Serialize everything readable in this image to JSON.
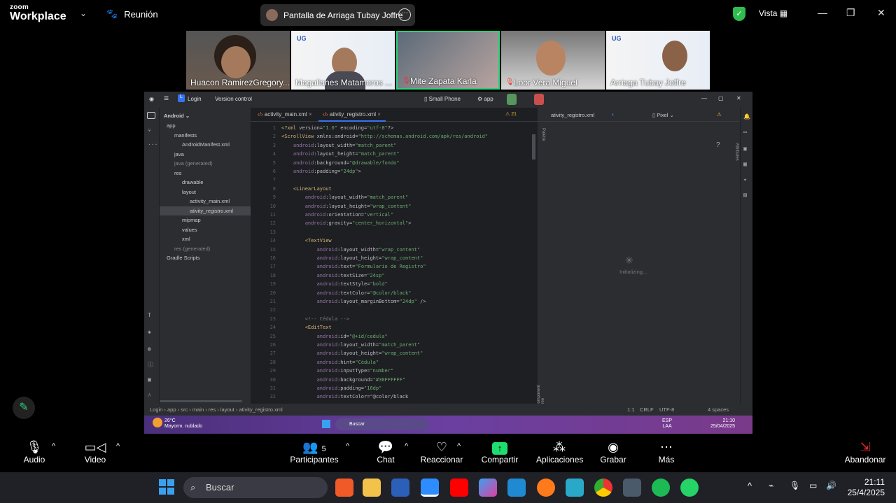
{
  "zoom": {
    "logo_line1": "zoom",
    "logo_line2": "Workplace",
    "meeting_label": "Reunión",
    "share_title": "Pantalla de Arriaga Tubay Joffre",
    "view_label": "Vista",
    "participants": [
      {
        "name": "Huacon RamirezGregory..."
      },
      {
        "name": "Magallanes Matamoros ..."
      },
      {
        "name": "Mite Zapata Karla"
      },
      {
        "name": "Loor Vera Miguel"
      },
      {
        "name": "Arriaga Tubay Joffre"
      }
    ],
    "toolbar": {
      "audio": "Audio",
      "video": "Video",
      "participants": "Participantes",
      "participants_count": "5",
      "chat": "Chat",
      "react": "Reaccionar",
      "share": "Compartir",
      "apps": "Aplicaciones",
      "record": "Grabar",
      "more": "Más",
      "leave": "Abandonar"
    }
  },
  "ide": {
    "project_name": "Login",
    "vcs": "Version control",
    "device": "Small Phone",
    "run_config": "app",
    "view_mode": "Android",
    "tree": [
      {
        "label": "app",
        "depth": 0
      },
      {
        "label": "manifests",
        "depth": 1
      },
      {
        "label": "AndroidManifest.xml",
        "depth": 2
      },
      {
        "label": "java",
        "depth": 1
      },
      {
        "label": "java (generated)",
        "depth": 1
      },
      {
        "label": "res",
        "depth": 1
      },
      {
        "label": "drawable",
        "depth": 2
      },
      {
        "label": "layout",
        "depth": 2
      },
      {
        "label": "activity_main.xml",
        "depth": 3
      },
      {
        "label": "ativity_registro.xml",
        "depth": 3
      },
      {
        "label": "mipmap",
        "depth": 2
      },
      {
        "label": "values",
        "depth": 2
      },
      {
        "label": "xml",
        "depth": 2
      },
      {
        "label": "res (generated)",
        "depth": 1
      },
      {
        "label": "Gradle Scripts",
        "depth": 0
      }
    ],
    "tabs": [
      "activity_main.xml",
      "ativity_registro.xml"
    ],
    "warnings": "21",
    "code_lines": [
      "<?xml version=\"1.0\" encoding=\"utf-8\"?>",
      "<ScrollView xmlns:android=\"http://schemas.android.com/apk/res/android\"",
      "    android:layout_width=\"match_parent\"",
      "    android:layout_height=\"match_parent\"",
      "    android:background=\"@drawable/fondo\"",
      "    android:padding=\"24dp\">",
      "",
      "    <LinearLayout",
      "        android:layout_width=\"match_parent\"",
      "        android:layout_height=\"wrap_content\"",
      "        android:orientation=\"vertical\"",
      "        android:gravity=\"center_horizontal\">",
      "",
      "        <TextView",
      "            android:layout_width=\"wrap_content\"",
      "            android:layout_height=\"wrap_content\"",
      "            android:text=\"Formulario de Registro\"",
      "            android:textSize=\"24sp\"",
      "            android:textStyle=\"bold\"",
      "            android:textColor=\"@color/black\"",
      "            android:layout_marginBottom=\"24dp\" />",
      "",
      "        <!-- Cédula -->",
      "        <EditText",
      "            android:id=\"@+id/cedula\"",
      "            android:layout_width=\"match_parent\"",
      "            android:layout_height=\"wrap_content\"",
      "            android:hint=\"Cédula\"",
      "            android:inputType=\"number\"",
      "            android:background=\"#30FFFFFF\"",
      "            android:padding=\"16dp\"",
      "            android:textColor=\"@color/black"
    ],
    "preview_file": "ativity_registro.xml",
    "preview_device": "Pixel",
    "preview_status": "Initializing...",
    "palette_label": "Palette",
    "component_tree_label": "Component Tree",
    "attributes_label": "Attributes",
    "breadcrumb": [
      "Login",
      "app",
      "src",
      "main",
      "res",
      "layout",
      "ativity_registro.xml"
    ],
    "status_right": [
      "1:1",
      "CRLF",
      "UTF-8",
      "4 spaces"
    ],
    "remote_taskbar": {
      "weather_temp": "26°C",
      "weather_desc": "Mayorm. nublado",
      "search": "Buscar",
      "lang": "ESP",
      "region": "LAA",
      "time": "21:10",
      "date": "25/04/2025"
    }
  },
  "taskbar": {
    "search": "Buscar",
    "time": "21:11",
    "date": "25/4/2025"
  },
  "colors": {
    "active_tile_border": "#2fd07a",
    "share_green": "#1fdc6e",
    "leave_red": "#e02828",
    "ide_bg": "#1e1f22"
  }
}
